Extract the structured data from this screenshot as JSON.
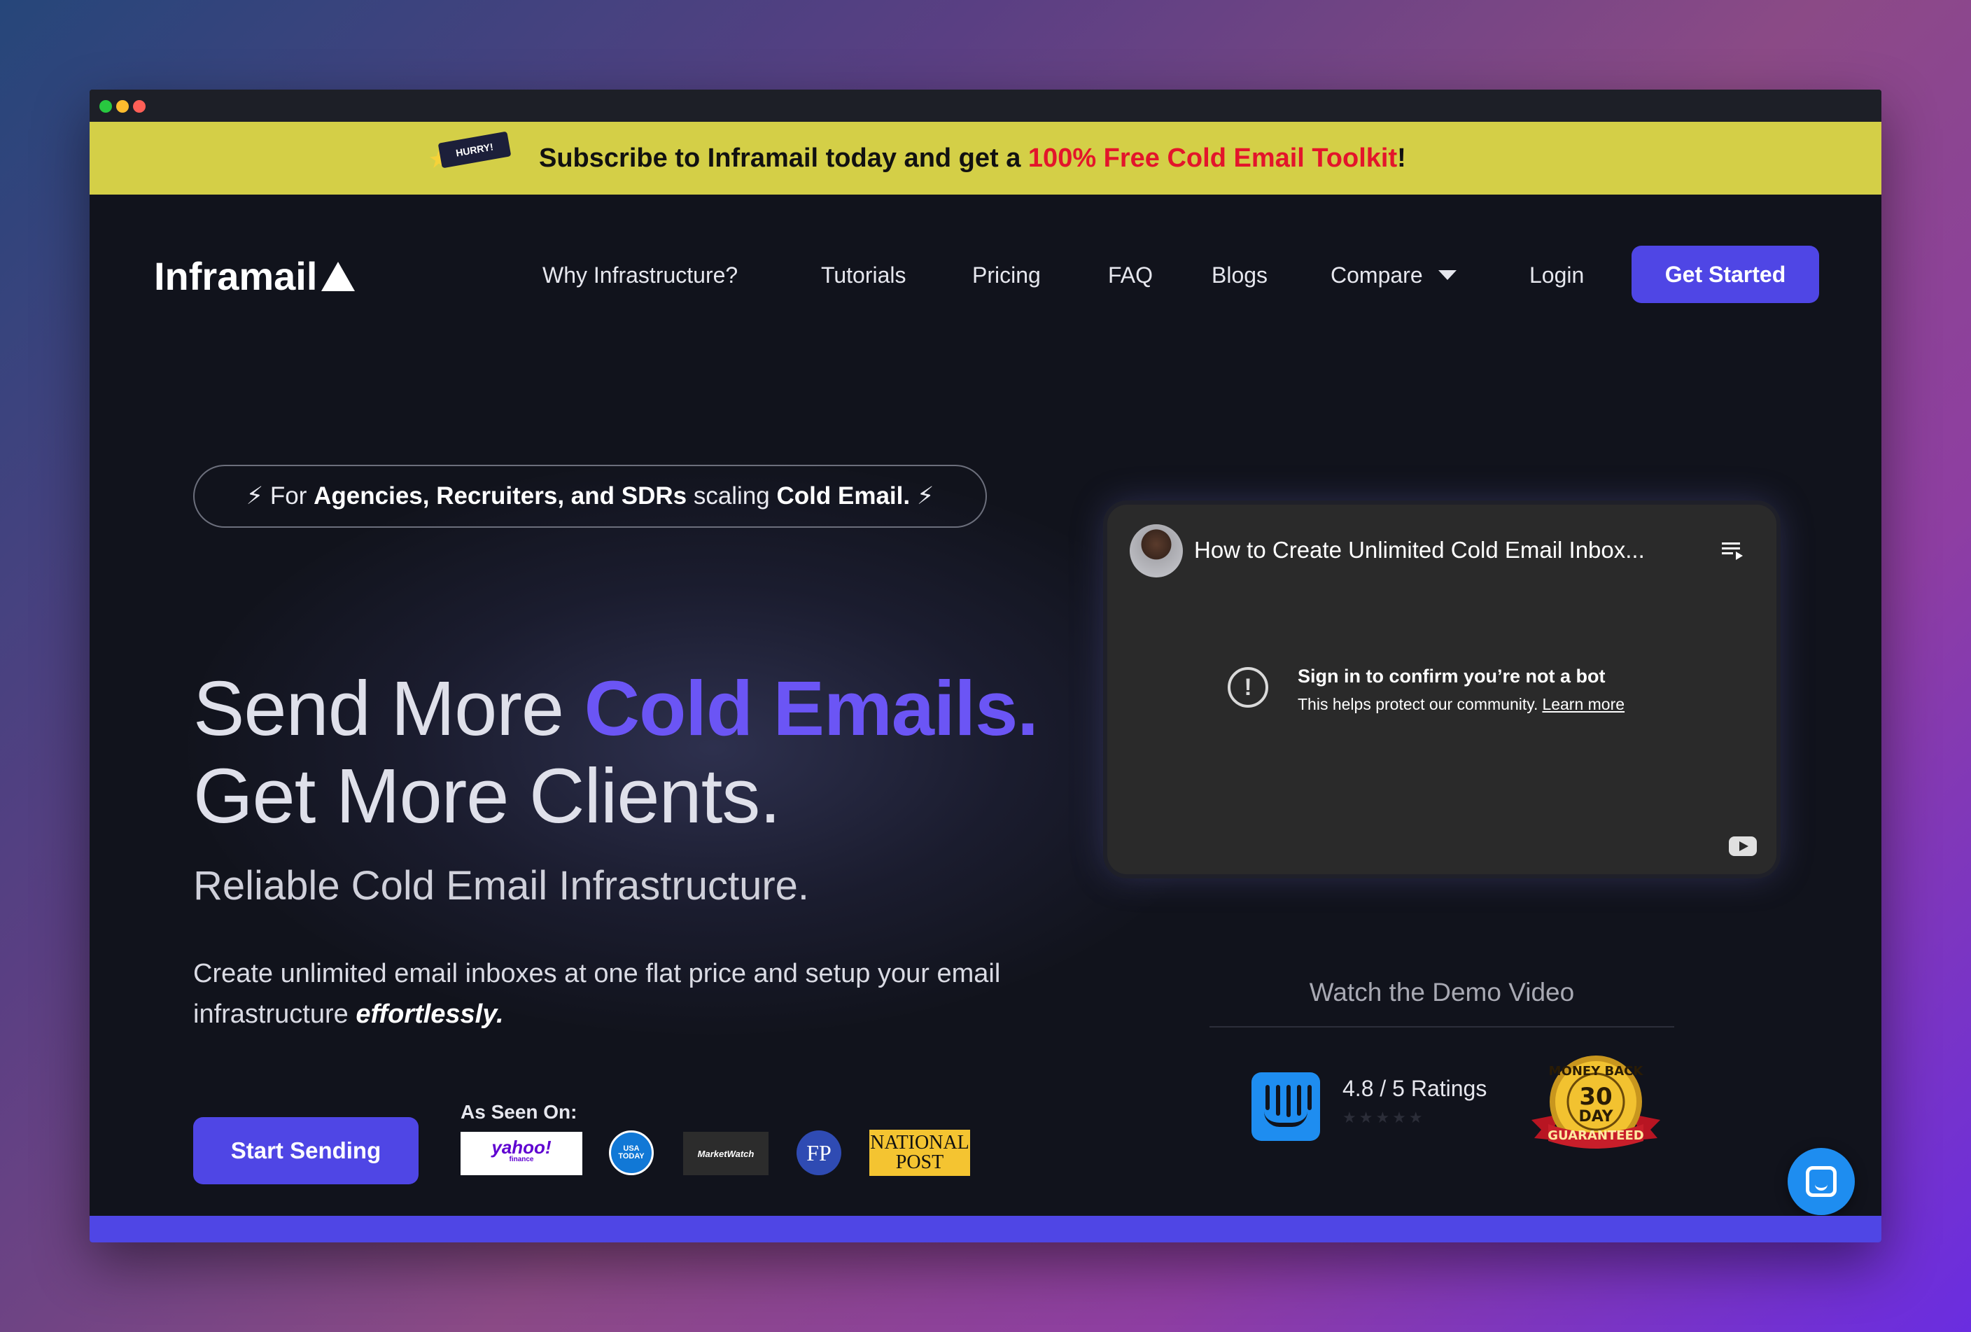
{
  "promo": {
    "tag": "HURRY!",
    "text_before": "Subscribe to Inframail today and get a ",
    "highlight": "100% Free Cold Email Toolkit",
    "text_after": "!"
  },
  "header": {
    "logo": "Inframail",
    "nav": [
      {
        "label": "Why Infrastructure?"
      },
      {
        "label": "Tutorials"
      },
      {
        "label": "Pricing"
      },
      {
        "label": "FAQ"
      },
      {
        "label": "Blogs"
      },
      {
        "label": "Compare"
      },
      {
        "label": "Login"
      }
    ],
    "cta": "Get Started"
  },
  "hero": {
    "pill": {
      "bolt": "⚡",
      "part1": "For ",
      "bold1": "Agencies, Recruiters, and SDRs",
      "part2": " scaling ",
      "bold2": "Cold Email."
    },
    "headline1_plain": "Send More ",
    "headline1_accent": "Cold Emails.",
    "headline2": "Get More Clients.",
    "subheadline": "Reliable Cold Email Infrastructure.",
    "paragraph_main": "Create unlimited email inboxes at one flat price and setup your email infrastructure ",
    "paragraph_em": "effortlessly.",
    "cta": "Start Sending",
    "as_seen_on": "As Seen On:",
    "press": [
      {
        "name": "yahoo!",
        "sub": "finance"
      },
      {
        "name": "USA TODAY"
      },
      {
        "name": "MarketWatch"
      },
      {
        "name": "FP"
      },
      {
        "name": "NATIONAL",
        "sub": "POST"
      }
    ]
  },
  "video": {
    "title": "How to Create Unlimited Cold Email Inbox...",
    "notice_title": "Sign in to confirm you’re not a bot",
    "notice_sub": "This helps protect our community.",
    "notice_link": "Learn more",
    "caption": "Watch the Demo Video"
  },
  "rating": {
    "text": "4.8 / 5 Ratings",
    "stars": "★★★★★"
  },
  "badge": {
    "top": "MONEY BACK",
    "number": "30",
    "day": "DAY",
    "ribbon": "GUARANTEED"
  },
  "colors": {
    "accent": "#4f46e5",
    "headline_accent": "#6b55f5",
    "promo_bg": "#d4cf47",
    "promo_highlight": "#e3152b",
    "page_bg": "#11131c"
  },
  "icons": [
    "hurry-icon",
    "logo-triangle-icon",
    "caret-down-icon",
    "bolt-icon",
    "playlist-icon",
    "alert-icon",
    "youtube-icon",
    "intercom-icon",
    "chat-icon"
  ]
}
